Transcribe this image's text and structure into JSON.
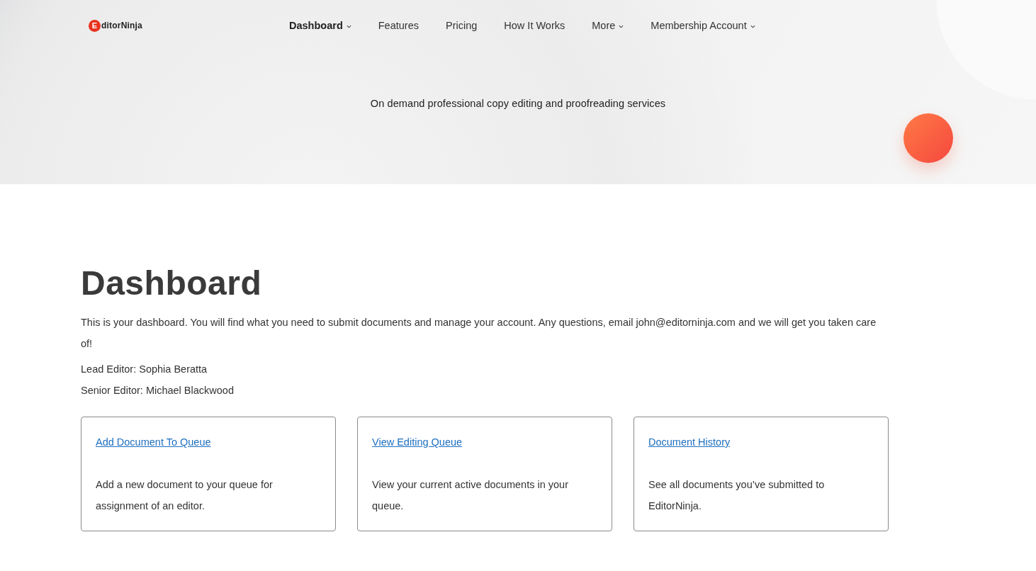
{
  "logo": {
    "initial": "E",
    "rest": "ditorNinja"
  },
  "nav": [
    {
      "label": "Dashboard",
      "selected": true,
      "dropdown": true
    },
    {
      "label": "Features",
      "selected": false,
      "dropdown": false
    },
    {
      "label": "Pricing",
      "selected": false,
      "dropdown": false
    },
    {
      "label": "How It Works",
      "selected": false,
      "dropdown": false
    },
    {
      "label": "More",
      "selected": false,
      "dropdown": true
    },
    {
      "label": "Membership Account",
      "selected": false,
      "dropdown": true
    }
  ],
  "tagline": "On demand professional copy editing and proofreading services",
  "heading": "Dashboard",
  "intro": "This is your dashboard. You will find what you need to submit documents and manage your account. Any questions, email john@editorninja.com and we will get you taken care of!",
  "editors": [
    "Lead Editor: Sophia Beratta",
    "Senior Editor: Michael Blackwood"
  ],
  "cards": [
    {
      "link": "Add Document To Queue",
      "text": "Add a new document to your queue for assignment of an editor."
    },
    {
      "link": "View Editing Queue",
      "text": "View your current active documents in your queue."
    },
    {
      "link": "Document History",
      "text": "See all documents you’ve submitted to EditorNinja."
    }
  ]
}
